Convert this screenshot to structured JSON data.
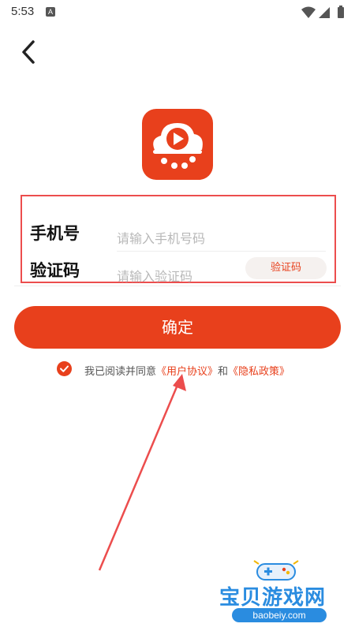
{
  "status_bar": {
    "time": "5:53",
    "notification_letter": "A"
  },
  "header": {
    "back_icon": "chevron-left-icon"
  },
  "logo": {
    "icon": "video-cloud-logo",
    "accent": "#e8401c"
  },
  "form": {
    "phone_label": "手机号",
    "phone_placeholder": "请输入手机号码",
    "code_label": "验证码",
    "code_placeholder": "请输入验证码",
    "get_code_label": "验证码"
  },
  "confirm_label": "确定",
  "agreement": {
    "prefix": "我已阅读并同意",
    "user_agreement": "《用户协议》",
    "connector": "和",
    "privacy_policy": "《隐私政策》",
    "checked": true
  },
  "watermark": {
    "title": "宝贝游戏网",
    "url": "baobeiy.com"
  }
}
